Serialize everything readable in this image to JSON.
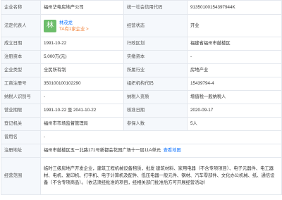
{
  "rows": {
    "r1": {
      "l1": "企业名称",
      "v1": "福州华电房地产公司",
      "l2": "统一社会信用代码",
      "v2": "91350100154397944K"
    },
    "r2": {
      "l1": "法定代表人",
      "avatar": "林",
      "rep_name": "林茂龙",
      "rep_tag": "TA有1家企业 >",
      "l2": "经营状态",
      "v2": "开业"
    },
    "r3": {
      "l1": "成立日期",
      "v1": "1991-10-22",
      "l2": "行政区划",
      "v2": "福建省福州市鼓楼区"
    },
    "r4": {
      "l1": "注册资本",
      "v1": "5,000万(元)",
      "l2": "实缴资本",
      "v2": "-"
    },
    "r5": {
      "l1": "企业类型",
      "v1": "全民所有制",
      "l2": "所属行业",
      "v2": "房地产业"
    },
    "r6": {
      "l1": "工商注册号",
      "v1": "350100100102290",
      "l2": "组织机构代码",
      "v2": "15439794-4"
    },
    "r7": {
      "l1": "纳税人识别号",
      "v1": "-",
      "l2": "纳税人资质",
      "v2": "增值税一般纳税人"
    },
    "r8": {
      "l1": "营业期限",
      "v1": "1991-10-22 至 2041-10-22",
      "l2": "核准日期",
      "v2": "2020-09-17"
    },
    "r9": {
      "l1": "登记机关",
      "v1": "福州市市场监督管理局",
      "l2": "参保人数",
      "v2": "5人"
    },
    "r10": {
      "l1": "曾用名",
      "v1": "-"
    },
    "r11": {
      "l1": "注册地址",
      "v1": "福州市鼓楼区五一北路171号新都会花园广场十一层11A单元",
      "link": "查看地图"
    },
    "r12": {
      "l1": "经营范围",
      "v1": "临时三级房地产开发企业，建筑工程机械设备租赁，批发 建筑材料、家用电器（不含专项项目）、电子元器件、电工器材、电机、复印机、打字机、电子计算机及配件、低压电器一般元件、钢材、汽车零部件、文化办公机械、纸、通信设备（不含专项商品）。（依法须经批准的项目，经相关部门批准后方可开展经营活动）"
    }
  }
}
